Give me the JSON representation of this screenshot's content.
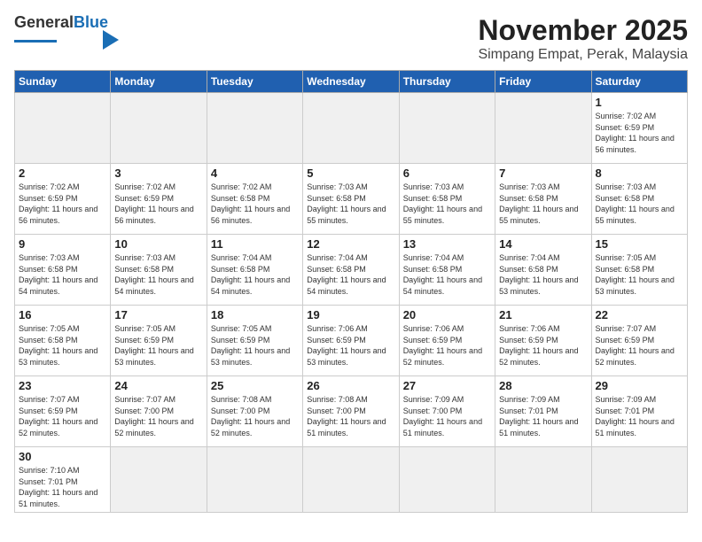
{
  "header": {
    "logo_general": "General",
    "logo_blue": "Blue",
    "month": "November 2025",
    "location": "Simpang Empat, Perak, Malaysia"
  },
  "weekdays": [
    "Sunday",
    "Monday",
    "Tuesday",
    "Wednesday",
    "Thursday",
    "Friday",
    "Saturday"
  ],
  "weeks": [
    [
      {
        "day": "",
        "info": ""
      },
      {
        "day": "",
        "info": ""
      },
      {
        "day": "",
        "info": ""
      },
      {
        "day": "",
        "info": ""
      },
      {
        "day": "",
        "info": ""
      },
      {
        "day": "",
        "info": ""
      },
      {
        "day": "1",
        "info": "Sunrise: 7:02 AM\nSunset: 6:59 PM\nDaylight: 11 hours\nand 56 minutes."
      }
    ],
    [
      {
        "day": "2",
        "info": "Sunrise: 7:02 AM\nSunset: 6:59 PM\nDaylight: 11 hours\nand 56 minutes."
      },
      {
        "day": "3",
        "info": "Sunrise: 7:02 AM\nSunset: 6:59 PM\nDaylight: 11 hours\nand 56 minutes."
      },
      {
        "day": "4",
        "info": "Sunrise: 7:02 AM\nSunset: 6:58 PM\nDaylight: 11 hours\nand 56 minutes."
      },
      {
        "day": "5",
        "info": "Sunrise: 7:03 AM\nSunset: 6:58 PM\nDaylight: 11 hours\nand 55 minutes."
      },
      {
        "day": "6",
        "info": "Sunrise: 7:03 AM\nSunset: 6:58 PM\nDaylight: 11 hours\nand 55 minutes."
      },
      {
        "day": "7",
        "info": "Sunrise: 7:03 AM\nSunset: 6:58 PM\nDaylight: 11 hours\nand 55 minutes."
      },
      {
        "day": "8",
        "info": "Sunrise: 7:03 AM\nSunset: 6:58 PM\nDaylight: 11 hours\nand 55 minutes."
      }
    ],
    [
      {
        "day": "9",
        "info": "Sunrise: 7:03 AM\nSunset: 6:58 PM\nDaylight: 11 hours\nand 54 minutes."
      },
      {
        "day": "10",
        "info": "Sunrise: 7:03 AM\nSunset: 6:58 PM\nDaylight: 11 hours\nand 54 minutes."
      },
      {
        "day": "11",
        "info": "Sunrise: 7:04 AM\nSunset: 6:58 PM\nDaylight: 11 hours\nand 54 minutes."
      },
      {
        "day": "12",
        "info": "Sunrise: 7:04 AM\nSunset: 6:58 PM\nDaylight: 11 hours\nand 54 minutes."
      },
      {
        "day": "13",
        "info": "Sunrise: 7:04 AM\nSunset: 6:58 PM\nDaylight: 11 hours\nand 54 minutes."
      },
      {
        "day": "14",
        "info": "Sunrise: 7:04 AM\nSunset: 6:58 PM\nDaylight: 11 hours\nand 53 minutes."
      },
      {
        "day": "15",
        "info": "Sunrise: 7:05 AM\nSunset: 6:58 PM\nDaylight: 11 hours\nand 53 minutes."
      }
    ],
    [
      {
        "day": "16",
        "info": "Sunrise: 7:05 AM\nSunset: 6:58 PM\nDaylight: 11 hours\nand 53 minutes."
      },
      {
        "day": "17",
        "info": "Sunrise: 7:05 AM\nSunset: 6:59 PM\nDaylight: 11 hours\nand 53 minutes."
      },
      {
        "day": "18",
        "info": "Sunrise: 7:05 AM\nSunset: 6:59 PM\nDaylight: 11 hours\nand 53 minutes."
      },
      {
        "day": "19",
        "info": "Sunrise: 7:06 AM\nSunset: 6:59 PM\nDaylight: 11 hours\nand 53 minutes."
      },
      {
        "day": "20",
        "info": "Sunrise: 7:06 AM\nSunset: 6:59 PM\nDaylight: 11 hours\nand 52 minutes."
      },
      {
        "day": "21",
        "info": "Sunrise: 7:06 AM\nSunset: 6:59 PM\nDaylight: 11 hours\nand 52 minutes."
      },
      {
        "day": "22",
        "info": "Sunrise: 7:07 AM\nSunset: 6:59 PM\nDaylight: 11 hours\nand 52 minutes."
      }
    ],
    [
      {
        "day": "23",
        "info": "Sunrise: 7:07 AM\nSunset: 6:59 PM\nDaylight: 11 hours\nand 52 minutes."
      },
      {
        "day": "24",
        "info": "Sunrise: 7:07 AM\nSunset: 7:00 PM\nDaylight: 11 hours\nand 52 minutes."
      },
      {
        "day": "25",
        "info": "Sunrise: 7:08 AM\nSunset: 7:00 PM\nDaylight: 11 hours\nand 52 minutes."
      },
      {
        "day": "26",
        "info": "Sunrise: 7:08 AM\nSunset: 7:00 PM\nDaylight: 11 hours\nand 51 minutes."
      },
      {
        "day": "27",
        "info": "Sunrise: 7:09 AM\nSunset: 7:00 PM\nDaylight: 11 hours\nand 51 minutes."
      },
      {
        "day": "28",
        "info": "Sunrise: 7:09 AM\nSunset: 7:01 PM\nDaylight: 11 hours\nand 51 minutes."
      },
      {
        "day": "29",
        "info": "Sunrise: 7:09 AM\nSunset: 7:01 PM\nDaylight: 11 hours\nand 51 minutes."
      }
    ],
    [
      {
        "day": "30",
        "info": "Sunrise: 7:10 AM\nSunset: 7:01 PM\nDaylight: 11 hours\nand 51 minutes."
      },
      {
        "day": "",
        "info": ""
      },
      {
        "day": "",
        "info": ""
      },
      {
        "day": "",
        "info": ""
      },
      {
        "day": "",
        "info": ""
      },
      {
        "day": "",
        "info": ""
      },
      {
        "day": "",
        "info": ""
      }
    ]
  ]
}
